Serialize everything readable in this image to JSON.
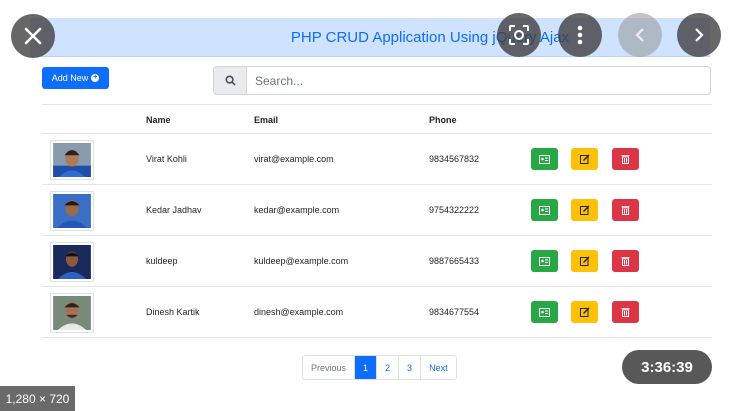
{
  "header": {
    "title": "PHP CRUD Application Using jQuery Ajax"
  },
  "toolbar": {
    "add_label": "Add New"
  },
  "search": {
    "placeholder": "Search..."
  },
  "table": {
    "columns": [
      "Name",
      "Email",
      "Phone"
    ],
    "rows": [
      {
        "name": "Virat Kohli",
        "email": "virat@example.com",
        "phone": "9834567832"
      },
      {
        "name": "Kedar Jadhav",
        "email": "kedar@example.com",
        "phone": "9754322222"
      },
      {
        "name": "kuldeep",
        "email": "kuldeep@example.com",
        "phone": "9887665433"
      },
      {
        "name": "Dinesh Kartik",
        "email": "dinesh@example.com",
        "phone": "9834677554"
      }
    ]
  },
  "pagination": {
    "previous": "Previous",
    "pages": [
      "1",
      "2",
      "3"
    ],
    "active": "1",
    "next": "Next"
  },
  "overlay": {
    "timer": "3:36:39",
    "dimensions": "1,280 × 720"
  },
  "colors": {
    "primary": "#0d6efd",
    "success": "#28a745",
    "warning": "#ffc107",
    "danger": "#dc3545"
  }
}
